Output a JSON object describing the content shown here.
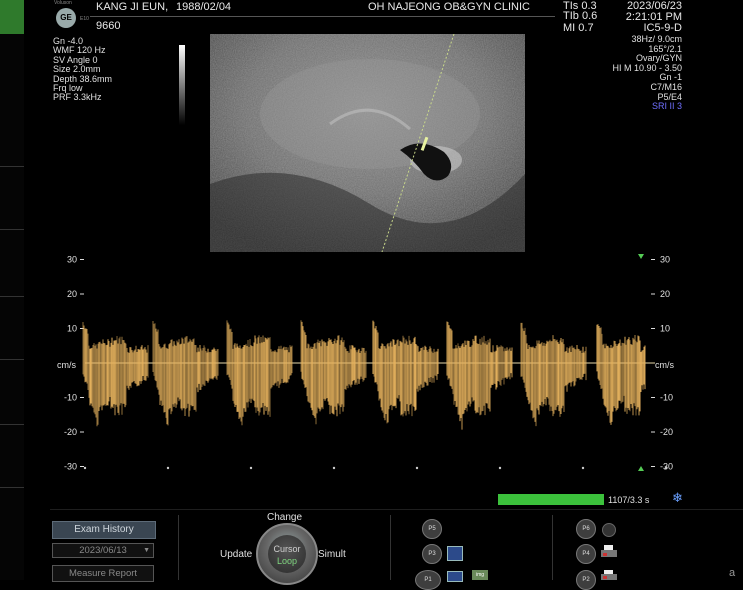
{
  "header": {
    "brand": "GE",
    "voluson_label": "Voluson",
    "model": "E10",
    "patient_name": "KANG JI EUN,",
    "birth_date": "1988/02/04",
    "patient_id": "9660",
    "clinic": "OH NAJEONG OB&GYN CLINIC",
    "tis": "TIs 0.3",
    "tib": "TIb 0.6",
    "mi": "MI 0.7",
    "date": "2023/06/23",
    "time": "2:21:01 PM",
    "probe": "IC5-9-D"
  },
  "left_params": [
    "Gn -4.0",
    "WMF 120 Hz",
    "SV Angle  0",
    "Size  2.0mm",
    "Depth 38.6mm",
    "Frq low",
    "PRF  3.3kHz"
  ],
  "right_params": [
    "38Hz/ 9.0cm",
    "165°/2.1",
    "Ovary/GYN",
    "HI M  10.90 - 3.50",
    "Gn  -1",
    "C7/M16",
    "P5/E4",
    "SRI II 3"
  ],
  "colors": {
    "sri_text": "#7070ff",
    "doppler_wave": "#e7b35e",
    "progress": "#3cc13c",
    "sidebar_active": "#2f7a2c"
  },
  "doppler": {
    "unit": "cm/s",
    "y_ticks": [
      "30",
      "20",
      "10",
      "-10",
      "-20",
      "-30"
    ]
  },
  "cine": {
    "frames_label": "1107/3.3 s",
    "progress_fraction": 1.0
  },
  "bottom": {
    "exam_history": "Exam History",
    "date_select": "2023/06/13",
    "measure_report": "Measure Report",
    "change": "Change",
    "update": "Update",
    "simult": "Simult",
    "cursor": "Cursor",
    "loop": "Loop",
    "p5": "P5",
    "p3": "P3",
    "p1": "P1",
    "p6": "P6",
    "p4": "P4",
    "p2": "P2",
    "img_label": "img"
  }
}
